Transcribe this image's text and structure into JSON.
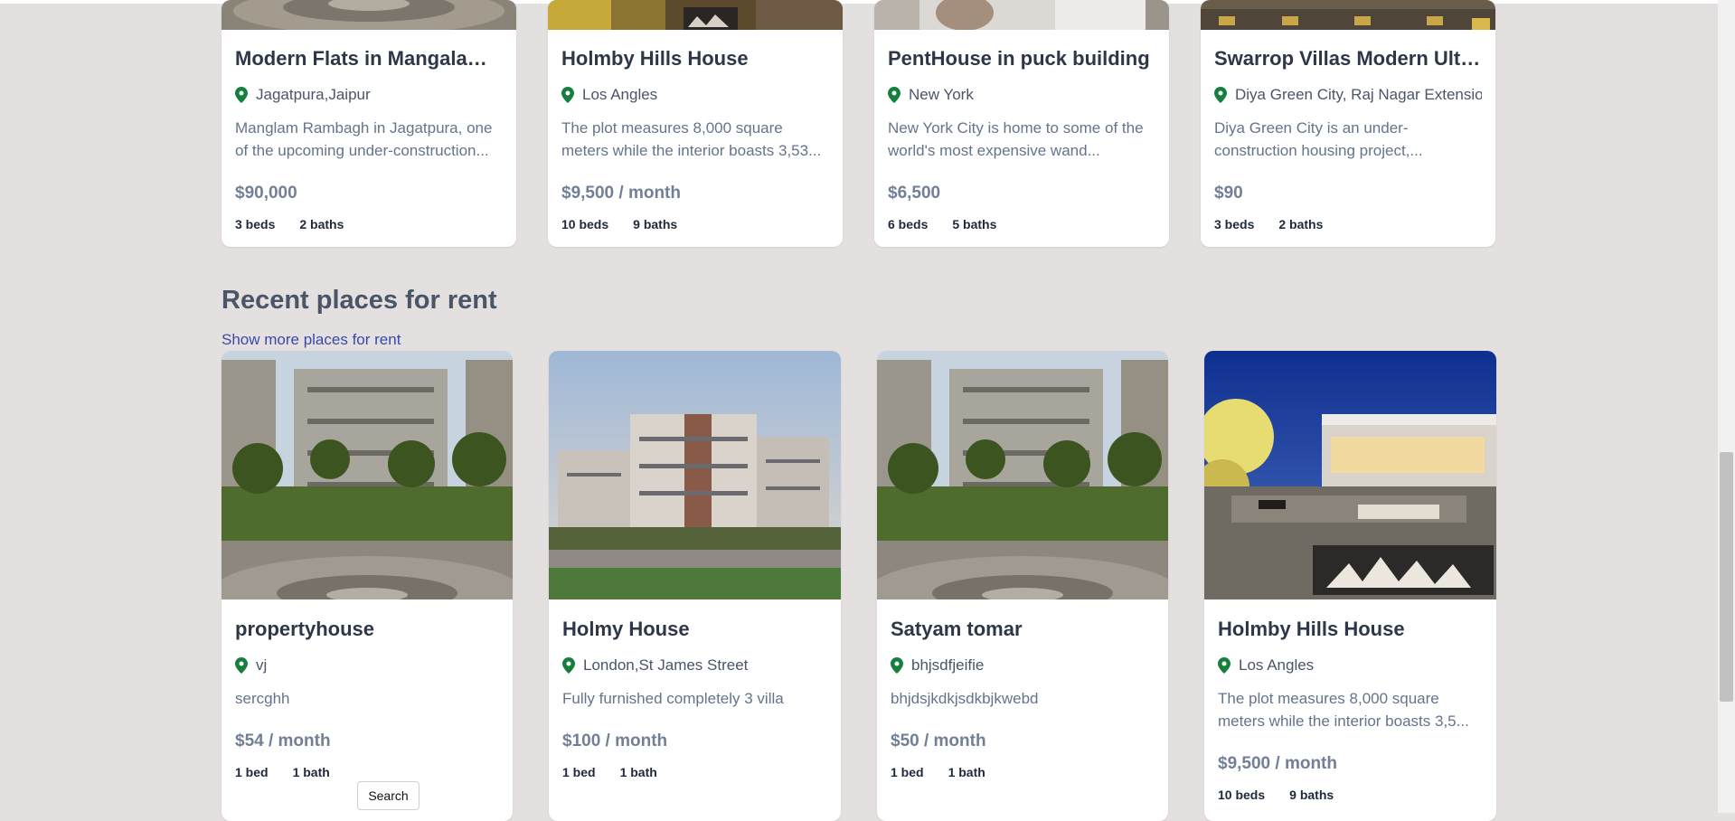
{
  "sale_cards": [
    {
      "title": "Modern Flats in Mangalam Rambagh",
      "location": "Jagatpura,Jaipur",
      "description": "Manglam Rambagh in Jagatpura, one of the upcoming under-construction...",
      "price": "$90,000",
      "beds": "3 beds",
      "baths": "2 baths"
    },
    {
      "title": "Holmby Hills House",
      "location": "Los Angles",
      "description": "The plot measures 8,000 square meters while the interior boasts 3,53...",
      "price": "$9,500 / month",
      "beds": "10 beds",
      "baths": "9 baths"
    },
    {
      "title": "PentHouse in puck building",
      "location": "New York",
      "description": "New York City is home to some of the world's most expensive wand...",
      "price": "$6,500",
      "beds": "6 beds",
      "baths": "5 baths"
    },
    {
      "title": "Swarrop Villas Modern Ultra Luxury",
      "location": "Diya Green City, Raj Nagar Extension",
      "description": "Diya Green City is an under-construction housing project,...",
      "price": "$90",
      "beds": "3 beds",
      "baths": "2 baths"
    }
  ],
  "rent_section": {
    "title": "Recent places for rent",
    "link": "Show more places for rent"
  },
  "rent_cards": [
    {
      "title": "propertyhouse",
      "location": "vj",
      "description": "sercghh",
      "price": "$54 / month",
      "beds": "1 bed",
      "baths": "1 bath"
    },
    {
      "title": "Holmy House",
      "location": "London,St James Street",
      "description": "Fully furnished completely 3 villa",
      "price": "$100 / month",
      "beds": "1 bed",
      "baths": "1 bath"
    },
    {
      "title": "Satyam tomar",
      "location": "bhjsdfjeifie",
      "description": "bhjdsjkdkjsdkbjkwebd",
      "price": "$50 / month",
      "beds": "1 bed",
      "baths": "1 bath"
    },
    {
      "title": "Holmby Hills House",
      "location": "Los Angles",
      "description": "The plot measures 8,000 square meters while the interior boasts 3,5...",
      "price": "$9,500 / month",
      "beds": "10 beds",
      "baths": "9 baths"
    }
  ],
  "search_button": "Search",
  "colors": {
    "background": "#e4e0df",
    "pin": "#15803d",
    "link": "#3949ab",
    "price": "#718096"
  },
  "icons": [
    "map-pin-icon"
  ]
}
